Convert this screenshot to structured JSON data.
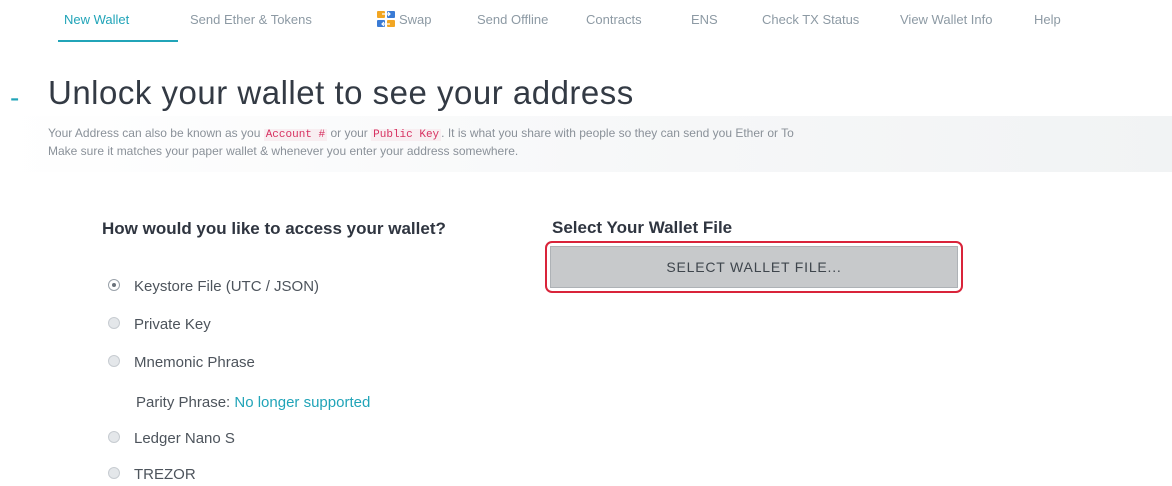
{
  "nav": {
    "items": [
      {
        "label": "New Wallet",
        "active": true
      },
      {
        "label": "Send Ether & Tokens"
      },
      {
        "label": "Swap",
        "icon": "swap-icon"
      },
      {
        "label": "Send Offline"
      },
      {
        "label": "Contracts"
      },
      {
        "label": "ENS"
      },
      {
        "label": "Check TX Status"
      },
      {
        "label": "View Wallet Info"
      },
      {
        "label": "Help"
      }
    ]
  },
  "header": {
    "dash": "-",
    "title": "Unlock your wallet to see your address",
    "desc": {
      "line1_a": "Your Address can also be known as you ",
      "code1": "Account #",
      "line1_b": " or your ",
      "code2": "Public Key",
      "line1_c": ". It is what you share with people so they can send you Ether or To",
      "line2": "Make sure it matches your paper wallet & whenever you enter your address somewhere."
    }
  },
  "access": {
    "title": "How would you like to access your wallet?",
    "options": [
      {
        "label": "Keystore File (UTC / JSON)",
        "checked": true
      },
      {
        "label": "Private Key"
      },
      {
        "label": "Mnemonic Phrase"
      },
      {
        "label": "Ledger Nano S"
      },
      {
        "label": "TREZOR"
      }
    ],
    "parity_label": "Parity Phrase: ",
    "parity_link": "No longer supported"
  },
  "wallet_file": {
    "title": "Select Your Wallet File",
    "button_label": "SELECT WALLET FILE..."
  },
  "colors": {
    "accent": "#21a4b8",
    "highlight": "#d9243a",
    "code": "#d73161"
  }
}
